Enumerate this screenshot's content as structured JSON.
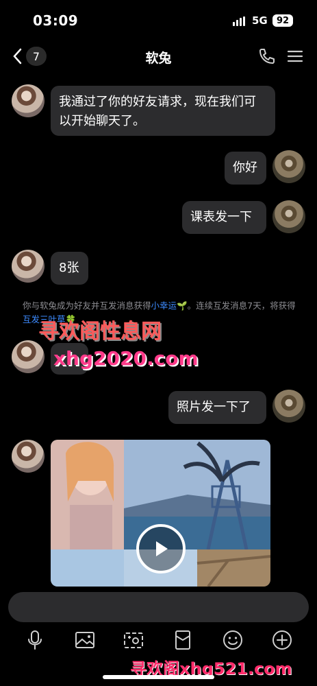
{
  "status": {
    "time": "03:09",
    "network": "5G",
    "battery": "92"
  },
  "header": {
    "unread_count": "7",
    "title": "软兔"
  },
  "messages": [
    {
      "side": "left",
      "text": "我通过了你的好友请求，现在我们可以开始聊天了。"
    },
    {
      "side": "right",
      "text": "你好"
    },
    {
      "side": "right",
      "text": "课表发一下"
    },
    {
      "side": "left",
      "text": "8张"
    },
    {
      "side": "right",
      "text": "照片发一下了"
    }
  ],
  "system_note": {
    "part1": "你与软兔成为好友并互发消息获得",
    "highlight1": "小幸运",
    "part2": "。连续互发消息7天，将获得",
    "highlight2": "互发三叶草",
    "part3": ""
  },
  "watermarks": {
    "top": "寻欢阁性息网",
    "middle": "xhg2020.com",
    "bottom": "寻欢阁xhg521.com"
  },
  "icons": [
    "microphone-icon",
    "image-icon",
    "camera-icon",
    "red-packet-icon",
    "emoji-icon",
    "plus-icon"
  ],
  "colors": {
    "background": "#000000",
    "bubble": "#2c2c2e",
    "link": "#3d8bff"
  }
}
